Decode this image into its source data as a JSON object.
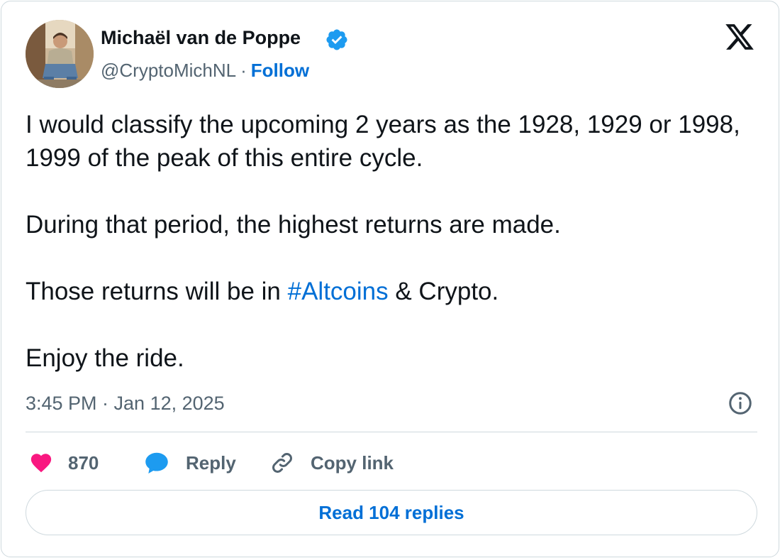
{
  "author": {
    "name": "Michaël van de Poppe",
    "handle": "@CryptoMichNL",
    "separator": "·",
    "follow_label": "Follow",
    "verified": true
  },
  "tweet": {
    "paragraphs": [
      {
        "text": "I would classify the upcoming 2 years as the 1928, 1929 or 1998, 1999 of the peak of this entire cycle."
      },
      {
        "text": "During that period, the highest returns are made."
      },
      {
        "before": "Those returns will be in ",
        "hashtag": "#Altcoins",
        "after": " & Crypto."
      },
      {
        "text": "Enjoy the ride."
      }
    ],
    "timestamp": "3:45 PM · Jan 12, 2025"
  },
  "actions": {
    "likes_count": "870",
    "reply_label": "Reply",
    "copy_link_label": "Copy link"
  },
  "read_replies_label": "Read 104 replies",
  "colors": {
    "link": "#006fd6",
    "secondary_text": "#536471",
    "heart": "#f91880",
    "reply_bubble": "#1d9bf0",
    "verified_badge": "#1d9bf0",
    "border": "#cfd9de"
  },
  "icons": {
    "verified": "verified-badge-icon",
    "logo": "x-logo-icon",
    "info": "info-icon",
    "like": "heart-icon",
    "reply": "speech-bubble-icon",
    "copy_link": "link-icon"
  }
}
